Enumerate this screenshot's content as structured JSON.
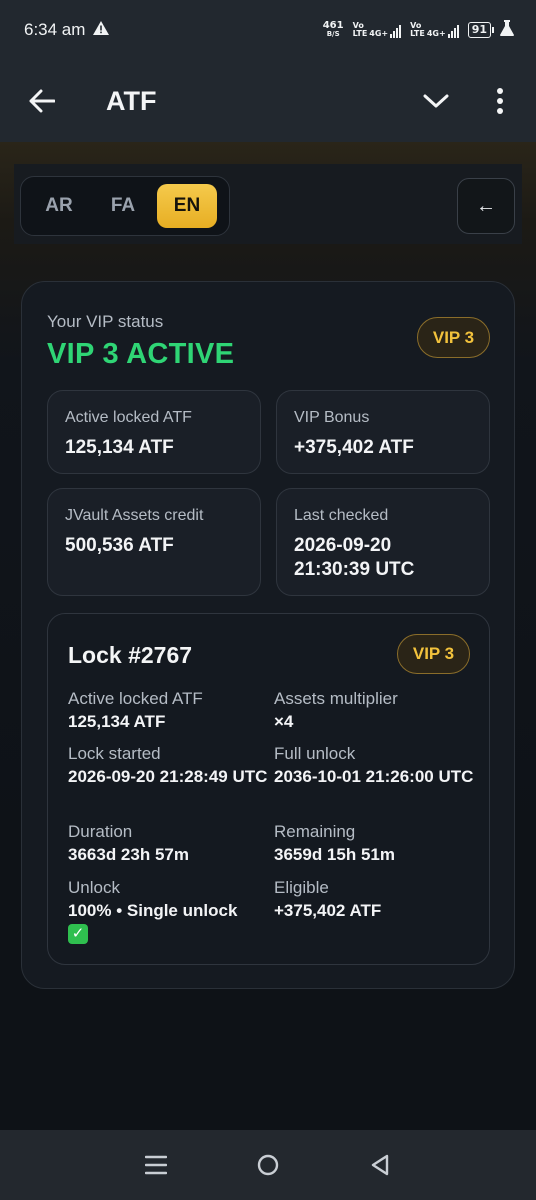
{
  "status_bar": {
    "time": "6:34 am",
    "net_speed_value": "461",
    "net_speed_unit": "B/S",
    "sim1_label_top": "Vo",
    "sim1_label_bottom": "LTE",
    "sim1_tech": "4G+",
    "sim2_label_top": "Vo",
    "sim2_label_bottom": "LTE",
    "sim2_tech": "4G+",
    "battery": "91"
  },
  "app_bar": {
    "title": "ATF"
  },
  "language": {
    "options": [
      "AR",
      "FA",
      "EN"
    ],
    "selected": "EN"
  },
  "arrow_button": "←",
  "vip": {
    "label": "Your VIP status",
    "status": "VIP 3 ACTIVE",
    "badge": "VIP 3",
    "stats": [
      {
        "label": "Active locked ATF",
        "value": "125,134 ATF"
      },
      {
        "label": "VIP Bonus",
        "value": "+375,402 ATF"
      },
      {
        "label": "JVault Assets credit",
        "value": "500,536 ATF"
      },
      {
        "label": "Last checked",
        "value": "2026-09-20 21:30:39 UTC"
      }
    ]
  },
  "lock": {
    "title": "Lock #2767",
    "badge": "VIP 3",
    "fields": [
      {
        "label": "Active locked ATF",
        "value": "125,134 ATF"
      },
      {
        "label": "Assets multiplier",
        "value": "×4"
      },
      {
        "label": "Lock started",
        "value": "2026-09-20 21:28:49 UTC"
      },
      {
        "label": "Full unlock",
        "value": "2036-10-01 21:26:00 UTC"
      },
      {
        "label": "Duration",
        "value": "3663d 23h 57m"
      },
      {
        "label": "Remaining",
        "value": "3659d 15h 51m"
      },
      {
        "label": "Unlock",
        "value": "100% • Single unlock"
      },
      {
        "label": "Eligible",
        "value": "+375,402 ATF"
      }
    ],
    "unlock_check": "✓"
  },
  "colors": {
    "accent_gold": "#f2c23c",
    "active_green": "#2fd575",
    "background": "#0f1216"
  },
  "icons": {
    "back": "arrow-left-icon",
    "dropdown": "chevron-down-icon",
    "menu": "more-vertical-icon",
    "nav_recents": "menu-lines-icon",
    "nav_home": "circle-home-icon",
    "nav_back": "triangle-back-icon"
  }
}
